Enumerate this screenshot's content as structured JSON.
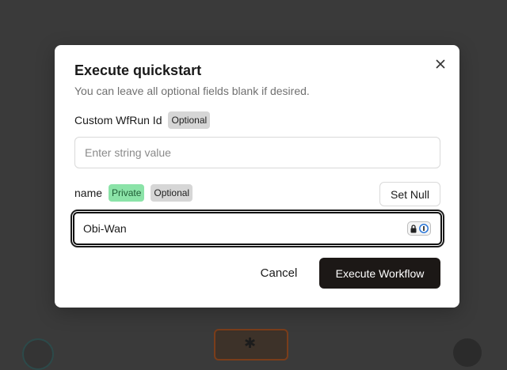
{
  "modal": {
    "title": "Execute quickstart",
    "subtitle": "You can leave all optional fields blank if desired."
  },
  "fields": [
    {
      "label": "Custom WfRun Id",
      "badges": [
        "Optional"
      ],
      "placeholder": "Enter string value",
      "value": ""
    },
    {
      "label": "name",
      "badges": [
        "Private",
        "Optional"
      ],
      "value": "Obi-Wan",
      "set_null_label": "Set Null"
    }
  ],
  "actions": {
    "cancel_label": "Cancel",
    "execute_label": "Execute Workflow"
  },
  "colors": {
    "overlay": "#3a3a3a",
    "primary_button": "#1c1816",
    "private_badge": "#8be3a8",
    "optional_badge": "#d6d6d6"
  },
  "icons": [
    "close-icon",
    "password-manager-icon",
    "gear-icon"
  ]
}
